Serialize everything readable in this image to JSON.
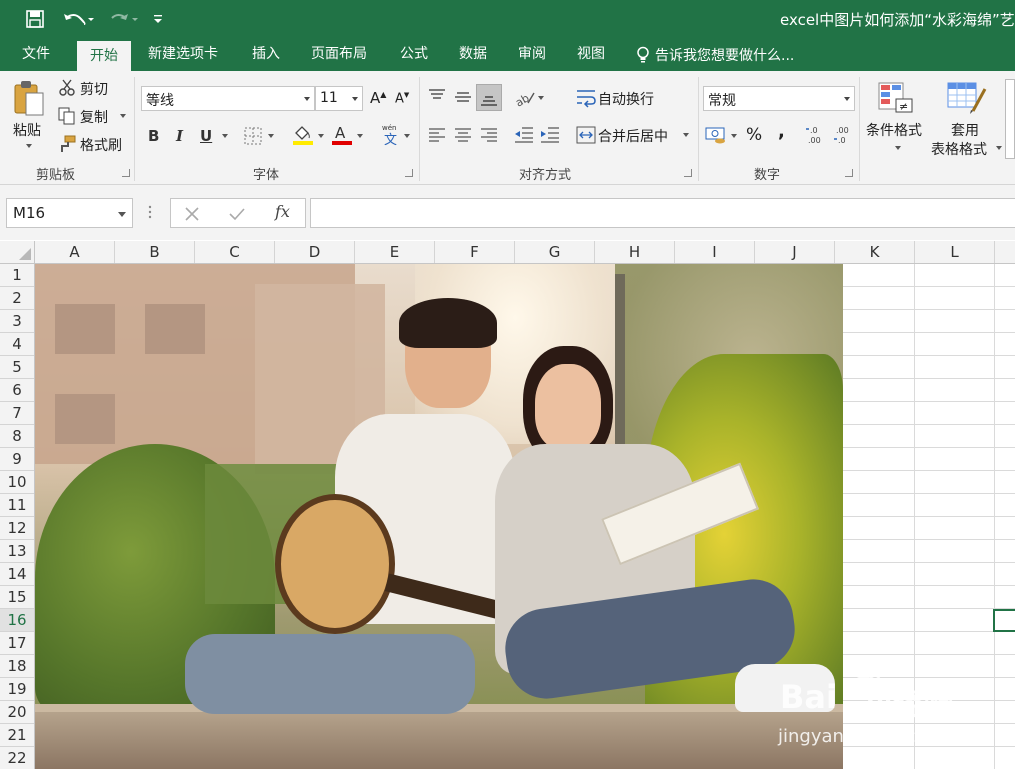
{
  "title_bar": {
    "document_title": "excel中图片如何添加“水彩海绵”艺术"
  },
  "tabs": [
    "文件",
    "开始",
    "新建选项卡",
    "插入",
    "页面布局",
    "公式",
    "数据",
    "审阅",
    "视图"
  ],
  "active_tab": "开始",
  "tell_me": "告诉我您想要做什么...",
  "ribbon": {
    "clipboard": {
      "paste": "粘贴",
      "cut": "剪切",
      "copy": "复制",
      "format_painter": "格式刷",
      "group_label": "剪贴板"
    },
    "font": {
      "font_name": "等线",
      "font_size": "11",
      "bold": "B",
      "italic": "I",
      "underline": "U",
      "group_label": "字体"
    },
    "alignment": {
      "wrap_text": "自动换行",
      "merge_center": "合并后居中",
      "group_label": "对齐方式"
    },
    "number": {
      "format": "常规",
      "percent": "%",
      "comma": ",",
      "group_label": "数字"
    },
    "styles": {
      "conditional_format_line1": "条件格式",
      "table_format_line1": "套用",
      "table_format_line2": "表格格式"
    }
  },
  "formula_bar": {
    "name_box": "M16",
    "fx": "fx",
    "formula": ""
  },
  "grid": {
    "columns": [
      "A",
      "B",
      "C",
      "D",
      "E",
      "F",
      "G",
      "H",
      "I",
      "J",
      "K",
      "L"
    ],
    "rows": [
      "1",
      "2",
      "3",
      "4",
      "5",
      "6",
      "7",
      "8",
      "9",
      "10",
      "11",
      "12",
      "13",
      "14",
      "15",
      "16",
      "17",
      "18",
      "19",
      "20",
      "21",
      "22"
    ],
    "selected_row": "16"
  },
  "watermark": {
    "brand": "Bai",
    "brand2": "du",
    "cn": "经验",
    "url": "jingyan.baidu.com"
  },
  "colors": {
    "accent": "#217346",
    "ribbon_bg": "#f3f3f3"
  }
}
